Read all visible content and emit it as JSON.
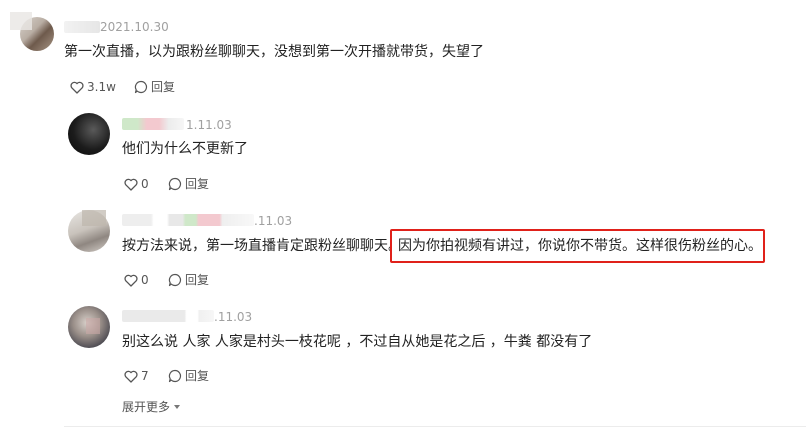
{
  "top_comment": {
    "date": "2021.10.30",
    "text": "第一次直播，以为跟粉丝聊聊天，没想到第一次开播就带货，失望了",
    "likes": "3.1w",
    "reply_label": "回复"
  },
  "replies": [
    {
      "date": "1.11.03",
      "text": "他们为什么不更新了",
      "likes": "0",
      "reply_label": "回复"
    },
    {
      "date": ".11.03",
      "text_before": "按方法来说，第一场直播肯定跟粉丝聊聊天。",
      "text_highlight": "因为你拍视频有讲过，你说你不带货。这样很伤粉丝的心。",
      "likes": "0",
      "reply_label": "回复"
    },
    {
      "date": ".11.03",
      "text": "别这么说 人家 人家是村头一枝花呢 ，不过自从她是花之后 ，牛粪 都没有了",
      "likes": "7",
      "reply_label": "回复"
    }
  ],
  "expand_more": "展开更多",
  "colors": {
    "highlight_border": "#e0211a",
    "text": "#222222",
    "meta": "#a0a0a0"
  },
  "icons": {
    "like": "heart-icon",
    "reply": "chat-bubble-icon",
    "expand": "caret-down-icon"
  }
}
